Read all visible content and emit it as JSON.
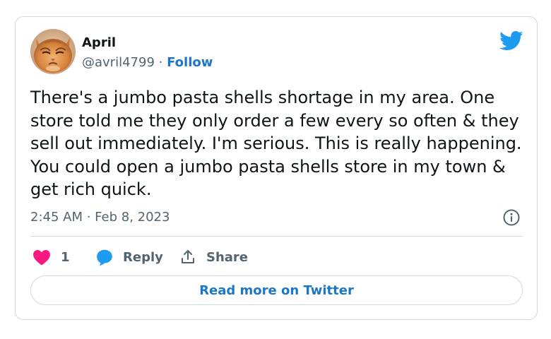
{
  "author": {
    "name": "April",
    "handle": "@avril4799",
    "separator": "·",
    "follow_label": "Follow",
    "avatar_icon": "orange-cat-avatar"
  },
  "tweet": {
    "text": "There's a jumbo pasta shells shortage in my area. One\nstore told me they only order a few every so often & they\nsell out immediately. I'm serious. This is really happening.\nYou could open a jumbo pasta shells store in my town &\nget rich quick.",
    "timestamp": "2:45 AM · Feb 8, 2023"
  },
  "actions": {
    "like_count": "1",
    "reply_label": "Reply",
    "share_label": "Share"
  },
  "footer": {
    "read_more_label": "Read more on Twitter"
  },
  "icons": {
    "brand": "twitter-bird-icon",
    "info": "info-icon",
    "like": "heart-icon",
    "reply": "reply-bubble-icon",
    "share": "share-upload-icon"
  },
  "colors": {
    "twitter_blue": "#1d9bf0",
    "link_blue": "#1d77c4",
    "heart_pink": "#f91880",
    "muted_text": "#536471",
    "border": "#cfd9de"
  }
}
